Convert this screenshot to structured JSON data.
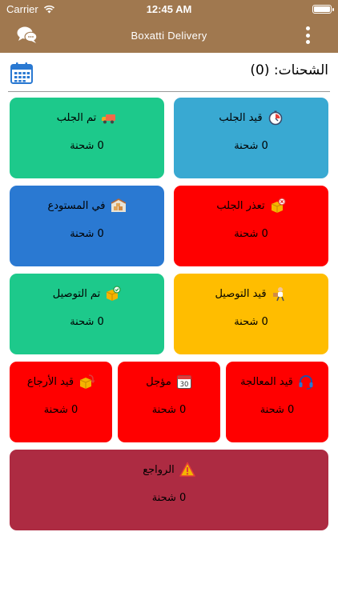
{
  "status_bar": {
    "carrier": "Carrier",
    "time": "12:45 AM"
  },
  "navbar": {
    "title": "Boxatti Delivery"
  },
  "shipments_header": {
    "title": "الشحنات: (0)"
  },
  "cards": [
    {
      "label": "قيد الجلب",
      "count": "0 شحنة",
      "icon": "stopwatch-icon",
      "color": "#39a9d2"
    },
    {
      "label": "تم الجلب",
      "count": "0 شحنة",
      "icon": "delivery-truck-icon",
      "color": "#1dc98b"
    },
    {
      "label": "تعذر الجلب",
      "count": "0 شحنة",
      "icon": "box-cancel-icon",
      "color": "#ff0000"
    },
    {
      "label": "في المستودع",
      "count": "0 شحنة",
      "icon": "warehouse-icon",
      "color": "#2a79d2"
    },
    {
      "label": "قيد التوصيل",
      "count": "0 شحنة",
      "icon": "courier-icon",
      "color": "#ffbd00"
    },
    {
      "label": "تم التوصيل",
      "count": "0 شحنة",
      "icon": "box-check-icon",
      "color": "#1dc98b"
    },
    {
      "label": "قيد المعالجة",
      "count": "0 شحنة",
      "icon": "headset-icon",
      "color": "#ff0000"
    },
    {
      "label": "مؤجل",
      "count": "0 شحنة",
      "icon": "calendar-30-icon",
      "color": "#ff0000"
    },
    {
      "label": "قيد الأرجاع",
      "count": "0 شحنة",
      "icon": "box-return-icon",
      "color": "#ff0000"
    },
    {
      "label": "الرواجع",
      "count": "0 شحنة",
      "icon": "warning-icon",
      "color": "#ad2b42"
    }
  ]
}
